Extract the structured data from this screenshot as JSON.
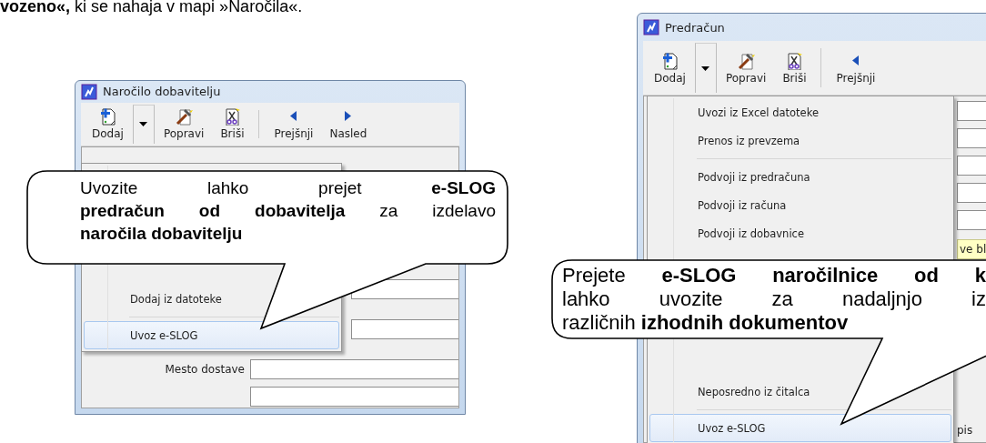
{
  "intro_text": "**vozeno«,** ki se nahaja v mapi »Naročila«.",
  "windows": [
    {
      "title": "Naročilo dobavitelju",
      "toolbar": [
        {
          "kind": "add",
          "label": "Dodaj"
        },
        {
          "kind": "dropdown"
        },
        {
          "kind": "edit",
          "label": "Popravi"
        },
        {
          "kind": "delete",
          "label": "Briši"
        },
        {
          "kind": "separator"
        },
        {
          "kind": "prev",
          "label": "Prejšnji"
        },
        {
          "kind": "next",
          "label": "Nasled"
        }
      ],
      "menu_bottom": [
        {
          "kind": "item",
          "label": "Dodaj iz datoteke",
          "selected": false
        },
        {
          "kind": "separator"
        },
        {
          "kind": "item",
          "label": "Uvoz e-SLOG",
          "selected": true
        }
      ],
      "form_rows": [
        {
          "kind": "field"
        },
        {
          "kind": "field"
        },
        {
          "kind": "labeled",
          "label": "Mesto dostave"
        },
        {
          "kind": "field"
        }
      ],
      "callout": {
        "lines": [
          "Uvozite lahko prejet **e-SLOG**",
          "**predračun od dobavitelja** za izdelavo",
          "**naročila dobavitelju**"
        ]
      }
    },
    {
      "title": "Predračun",
      "toolbar": [
        {
          "kind": "add",
          "label": "Dodaj"
        },
        {
          "kind": "dropdown"
        },
        {
          "kind": "edit",
          "label": "Popravi"
        },
        {
          "kind": "delete",
          "label": "Briši"
        },
        {
          "kind": "separator"
        },
        {
          "kind": "prev",
          "label": "Prejšnji"
        }
      ],
      "menu_top": [
        {
          "kind": "item",
          "label": "Uvozi iz Excel datoteke",
          "selected": false
        },
        {
          "kind": "item",
          "label": "Prenos iz prevzema",
          "selected": false
        },
        {
          "kind": "separator"
        },
        {
          "kind": "item",
          "label": "Podvoji iz predračuna",
          "selected": false
        },
        {
          "kind": "item",
          "label": "Podvoji iz računa",
          "selected": false
        },
        {
          "kind": "item",
          "label": "Podvoji iz dobavnice",
          "selected": false
        }
      ],
      "menu_bottom": [
        {
          "kind": "item",
          "label": "Neposredno iz čitalca",
          "selected": false
        },
        {
          "kind": "separator"
        },
        {
          "kind": "item",
          "label": "Uvoz e-SLOG",
          "selected": true
        }
      ],
      "form_rows": [
        {
          "kind": "field"
        },
        {
          "kind": "field"
        },
        {
          "kind": "field"
        },
        {
          "kind": "field"
        },
        {
          "kind": "field"
        },
        {
          "kind": "hint",
          "text": "ve bl"
        },
        {
          "kind": "label",
          "label": "pis"
        }
      ],
      "callout": {
        "lines": [
          "Prejete **e-SLOG naročilnice od k**",
          "lahko uvozite za nadaljnjo iz",
          "različnih **izhodnih dokumentov**"
        ]
      }
    }
  ]
}
